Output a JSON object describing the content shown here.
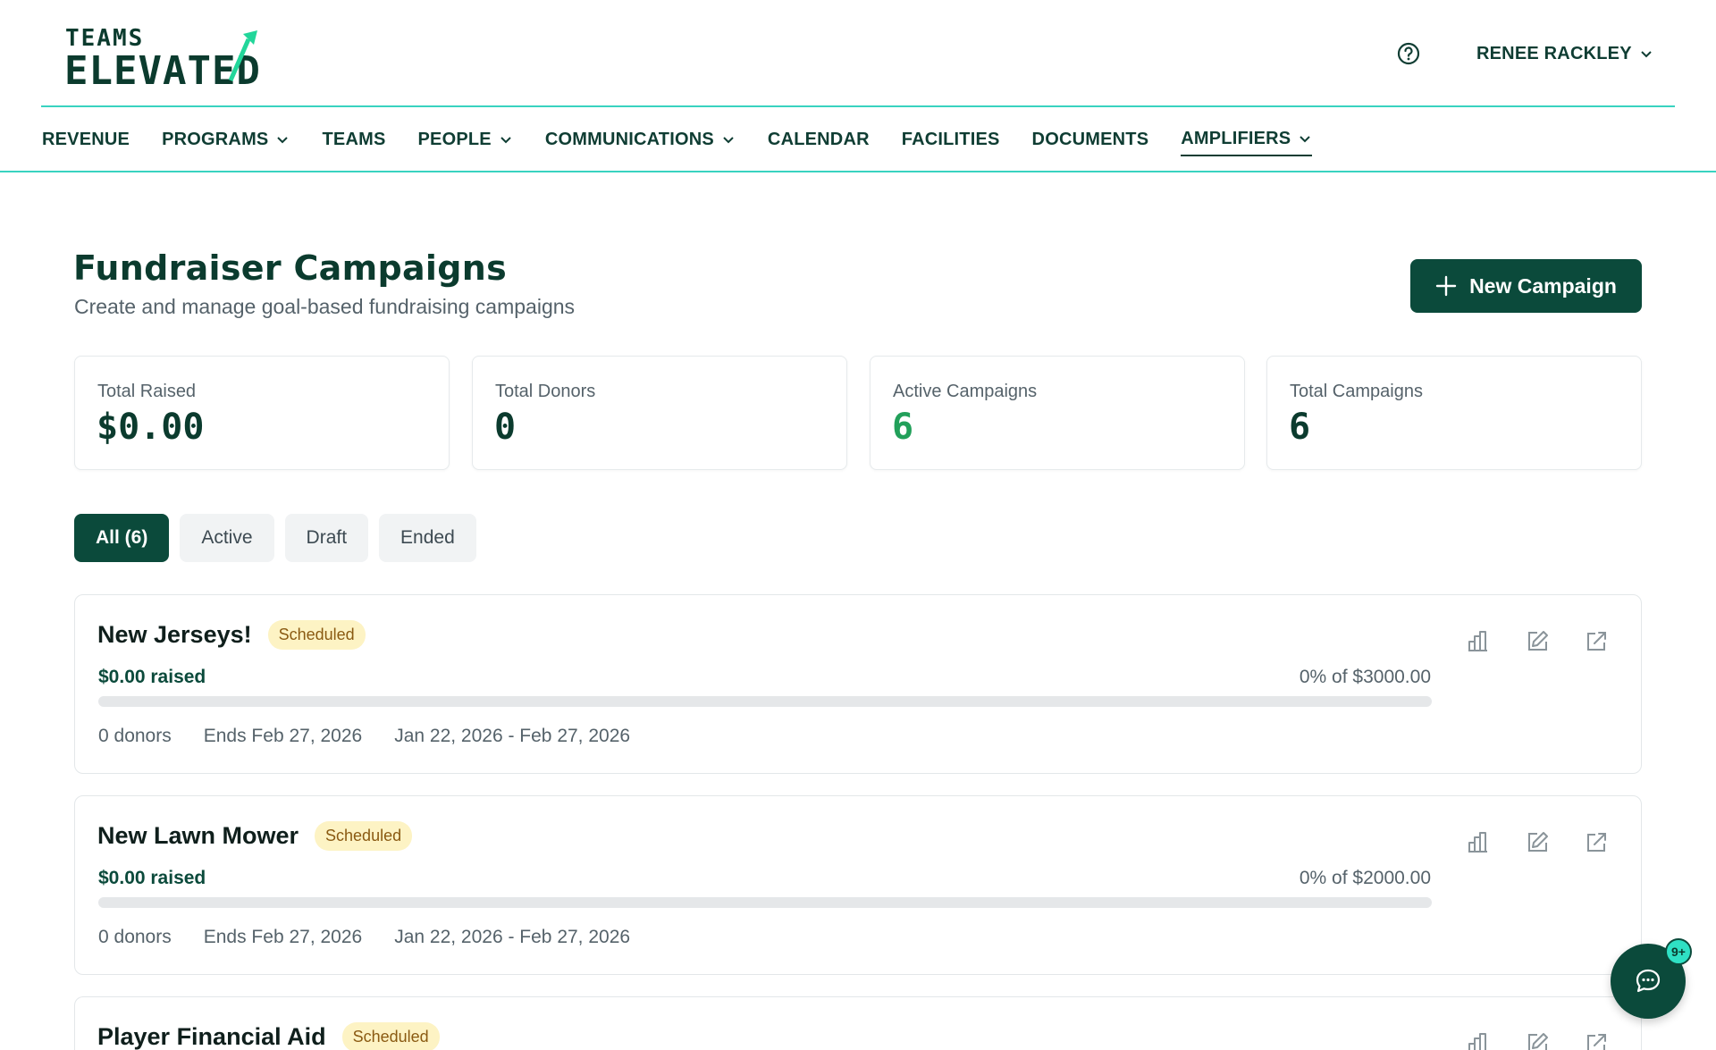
{
  "brand": {
    "line1": "TEAMS",
    "line2": "ELEVATED"
  },
  "user": {
    "name": "RENEE RACKLEY"
  },
  "nav": [
    {
      "label": "REVENUE",
      "dropdown": false
    },
    {
      "label": "PROGRAMS",
      "dropdown": true
    },
    {
      "label": "TEAMS",
      "dropdown": false
    },
    {
      "label": "PEOPLE",
      "dropdown": true
    },
    {
      "label": "COMMUNICATIONS",
      "dropdown": true
    },
    {
      "label": "CALENDAR",
      "dropdown": false
    },
    {
      "label": "FACILITIES",
      "dropdown": false
    },
    {
      "label": "DOCUMENTS",
      "dropdown": false
    },
    {
      "label": "AMPLIFIERS",
      "dropdown": true,
      "active": true
    }
  ],
  "page": {
    "title": "Fundraiser Campaigns",
    "subtitle": "Create and manage goal-based fundraising campaigns",
    "new_button": "New Campaign"
  },
  "stats": [
    {
      "label": "Total Raised",
      "value": "$0.00"
    },
    {
      "label": "Total Donors",
      "value": "0"
    },
    {
      "label": "Active Campaigns",
      "value": "6"
    },
    {
      "label": "Total Campaigns",
      "value": "6"
    }
  ],
  "filters": [
    "All (6)",
    "Active",
    "Draft",
    "Ended"
  ],
  "campaigns": [
    {
      "name": "New Jerseys!",
      "status": "Scheduled",
      "raised": "$0.00 raised",
      "goal_text": "0% of $3000.00",
      "progress": 0,
      "donors": "0 donors",
      "ends": "Ends Feb 27, 2026",
      "range": "Jan 22, 2026 - Feb 27, 2026"
    },
    {
      "name": "New Lawn Mower",
      "status": "Scheduled",
      "raised": "$0.00 raised",
      "goal_text": "0% of $2000.00",
      "progress": 0,
      "donors": "0 donors",
      "ends": "Ends Feb 27, 2026",
      "range": "Jan 22, 2026 - Feb 27, 2026"
    },
    {
      "name": "Player Financial Aid",
      "status": "Scheduled"
    }
  ],
  "chat": {
    "badge": "9+"
  },
  "colors": {
    "primary": "#0b4a3b",
    "accent": "#39d3c0",
    "badge_bg": "#fdf3c4",
    "active_green": "#22a05a"
  }
}
